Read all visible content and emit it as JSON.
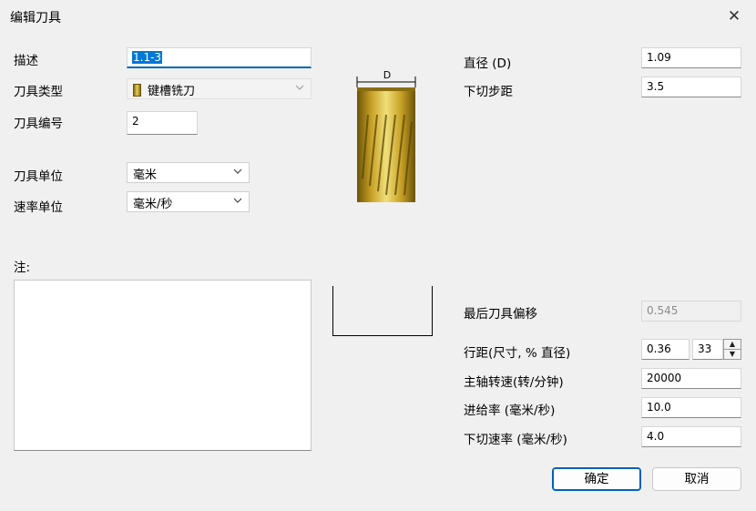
{
  "window": {
    "title": "编辑刀具"
  },
  "left": {
    "desc_label": "描述",
    "desc_value": "1.1-3",
    "type_label": "刀具类型",
    "type_value": "键槽铣刀",
    "number_label": "刀具编号",
    "number_value": "2",
    "unit_label": "刀具单位",
    "unit_value": "毫米",
    "rate_unit_label": "速率单位",
    "rate_unit_value": "毫米/秒",
    "notes_label": "注:",
    "notes_value": ""
  },
  "preview": {
    "dim_label": "D"
  },
  "right": {
    "diameter_label": "直径 (D)",
    "diameter_value": "1.09",
    "stepdown_label": "下切步距",
    "stepdown_value": "3.5",
    "offset_label": "最后刀具偏移",
    "offset_value": "0.545",
    "stepover_label": "行距(尺寸, % 直径)",
    "stepover_value": "0.36",
    "stepover_pct": "33",
    "spindle_label": "主轴转速(转/分钟)",
    "spindle_value": "20000",
    "feed_label": "进给率 (毫米/秒)",
    "feed_value": "10.0",
    "plunge_label": "下切速率 (毫米/秒)",
    "plunge_value": "4.0"
  },
  "buttons": {
    "ok": "确定",
    "cancel": "取消"
  },
  "icons": {
    "close": "close-icon",
    "tool_type": "endmill-icon",
    "dropdown": "chevron-down-icon",
    "spin_up": "arrow-up-icon",
    "spin_down": "arrow-down-icon"
  },
  "colors": {
    "accent": "#0067c0",
    "selection": "#0078d7",
    "tool_gold": "#c9a227"
  }
}
